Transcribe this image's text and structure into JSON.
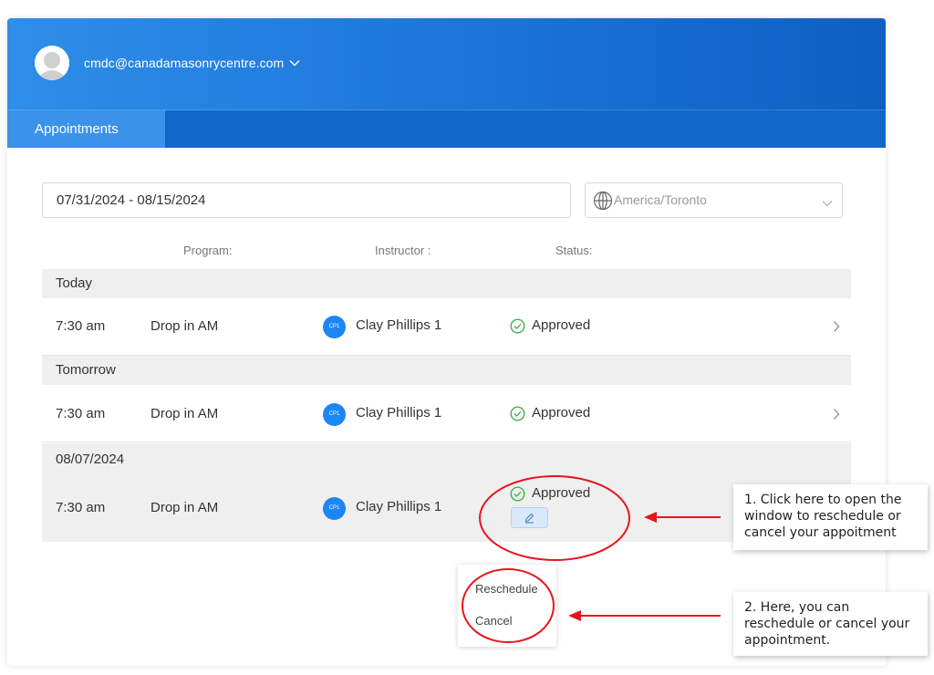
{
  "header": {
    "user_email": "cmdc@canadamasonrycentre.com",
    "tab_appointments": "Appointments"
  },
  "filters": {
    "date_range": "07/31/2024 - 08/15/2024",
    "timezone": "America/Toronto"
  },
  "columns": {
    "program": "Program:",
    "instructor": "Instructor :",
    "status": "Status:"
  },
  "groups": [
    {
      "label": "Today",
      "appointment": {
        "time": "7:30 am",
        "program": "Drop in AM",
        "instructor_initials": "CP1",
        "instructor": "Clay Phillips 1",
        "status": "Approved"
      }
    },
    {
      "label": "Tomorrow",
      "appointment": {
        "time": "7:30 am",
        "program": "Drop in AM",
        "instructor_initials": "CP1",
        "instructor": "Clay Phillips 1",
        "status": "Approved"
      }
    },
    {
      "label": "08/07/2024",
      "appointment": {
        "time": "7:30 am",
        "program": "Drop in AM",
        "instructor_initials": "CP1",
        "instructor": "Clay Phillips 1",
        "status": "Approved"
      }
    }
  ],
  "popup_menu": {
    "reschedule": "Reschedule",
    "cancel": "Cancel"
  },
  "callouts": {
    "step1": "1. Click here to open the window to reschedule or cancel your appoitment",
    "step2": "2. Here, you can reschedule or cancel your appointment."
  },
  "colors": {
    "header_gradient_start": "#2f8ee8",
    "header_gradient_end": "#0f5fc2",
    "active_tab": "#3a92ea",
    "status_green": "#3cb54a",
    "annotation_red": "#e8141c",
    "instructor_badge": "#1c86f2"
  }
}
